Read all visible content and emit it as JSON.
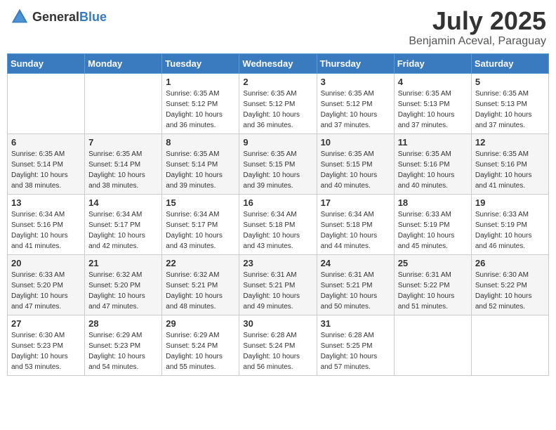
{
  "header": {
    "logo_general": "General",
    "logo_blue": "Blue",
    "title": "July 2025",
    "subtitle": "Benjamin Aceval, Paraguay"
  },
  "calendar": {
    "weekdays": [
      "Sunday",
      "Monday",
      "Tuesday",
      "Wednesday",
      "Thursday",
      "Friday",
      "Saturday"
    ],
    "weeks": [
      [
        {
          "day": null,
          "sunrise": null,
          "sunset": null,
          "daylight": null
        },
        {
          "day": null,
          "sunrise": null,
          "sunset": null,
          "daylight": null
        },
        {
          "day": "1",
          "sunrise": "Sunrise: 6:35 AM",
          "sunset": "Sunset: 5:12 PM",
          "daylight": "Daylight: 10 hours and 36 minutes."
        },
        {
          "day": "2",
          "sunrise": "Sunrise: 6:35 AM",
          "sunset": "Sunset: 5:12 PM",
          "daylight": "Daylight: 10 hours and 36 minutes."
        },
        {
          "day": "3",
          "sunrise": "Sunrise: 6:35 AM",
          "sunset": "Sunset: 5:12 PM",
          "daylight": "Daylight: 10 hours and 37 minutes."
        },
        {
          "day": "4",
          "sunrise": "Sunrise: 6:35 AM",
          "sunset": "Sunset: 5:13 PM",
          "daylight": "Daylight: 10 hours and 37 minutes."
        },
        {
          "day": "5",
          "sunrise": "Sunrise: 6:35 AM",
          "sunset": "Sunset: 5:13 PM",
          "daylight": "Daylight: 10 hours and 37 minutes."
        }
      ],
      [
        {
          "day": "6",
          "sunrise": "Sunrise: 6:35 AM",
          "sunset": "Sunset: 5:14 PM",
          "daylight": "Daylight: 10 hours and 38 minutes."
        },
        {
          "day": "7",
          "sunrise": "Sunrise: 6:35 AM",
          "sunset": "Sunset: 5:14 PM",
          "daylight": "Daylight: 10 hours and 38 minutes."
        },
        {
          "day": "8",
          "sunrise": "Sunrise: 6:35 AM",
          "sunset": "Sunset: 5:14 PM",
          "daylight": "Daylight: 10 hours and 39 minutes."
        },
        {
          "day": "9",
          "sunrise": "Sunrise: 6:35 AM",
          "sunset": "Sunset: 5:15 PM",
          "daylight": "Daylight: 10 hours and 39 minutes."
        },
        {
          "day": "10",
          "sunrise": "Sunrise: 6:35 AM",
          "sunset": "Sunset: 5:15 PM",
          "daylight": "Daylight: 10 hours and 40 minutes."
        },
        {
          "day": "11",
          "sunrise": "Sunrise: 6:35 AM",
          "sunset": "Sunset: 5:16 PM",
          "daylight": "Daylight: 10 hours and 40 minutes."
        },
        {
          "day": "12",
          "sunrise": "Sunrise: 6:35 AM",
          "sunset": "Sunset: 5:16 PM",
          "daylight": "Daylight: 10 hours and 41 minutes."
        }
      ],
      [
        {
          "day": "13",
          "sunrise": "Sunrise: 6:34 AM",
          "sunset": "Sunset: 5:16 PM",
          "daylight": "Daylight: 10 hours and 41 minutes."
        },
        {
          "day": "14",
          "sunrise": "Sunrise: 6:34 AM",
          "sunset": "Sunset: 5:17 PM",
          "daylight": "Daylight: 10 hours and 42 minutes."
        },
        {
          "day": "15",
          "sunrise": "Sunrise: 6:34 AM",
          "sunset": "Sunset: 5:17 PM",
          "daylight": "Daylight: 10 hours and 43 minutes."
        },
        {
          "day": "16",
          "sunrise": "Sunrise: 6:34 AM",
          "sunset": "Sunset: 5:18 PM",
          "daylight": "Daylight: 10 hours and 43 minutes."
        },
        {
          "day": "17",
          "sunrise": "Sunrise: 6:34 AM",
          "sunset": "Sunset: 5:18 PM",
          "daylight": "Daylight: 10 hours and 44 minutes."
        },
        {
          "day": "18",
          "sunrise": "Sunrise: 6:33 AM",
          "sunset": "Sunset: 5:19 PM",
          "daylight": "Daylight: 10 hours and 45 minutes."
        },
        {
          "day": "19",
          "sunrise": "Sunrise: 6:33 AM",
          "sunset": "Sunset: 5:19 PM",
          "daylight": "Daylight: 10 hours and 46 minutes."
        }
      ],
      [
        {
          "day": "20",
          "sunrise": "Sunrise: 6:33 AM",
          "sunset": "Sunset: 5:20 PM",
          "daylight": "Daylight: 10 hours and 47 minutes."
        },
        {
          "day": "21",
          "sunrise": "Sunrise: 6:32 AM",
          "sunset": "Sunset: 5:20 PM",
          "daylight": "Daylight: 10 hours and 47 minutes."
        },
        {
          "day": "22",
          "sunrise": "Sunrise: 6:32 AM",
          "sunset": "Sunset: 5:21 PM",
          "daylight": "Daylight: 10 hours and 48 minutes."
        },
        {
          "day": "23",
          "sunrise": "Sunrise: 6:31 AM",
          "sunset": "Sunset: 5:21 PM",
          "daylight": "Daylight: 10 hours and 49 minutes."
        },
        {
          "day": "24",
          "sunrise": "Sunrise: 6:31 AM",
          "sunset": "Sunset: 5:21 PM",
          "daylight": "Daylight: 10 hours and 50 minutes."
        },
        {
          "day": "25",
          "sunrise": "Sunrise: 6:31 AM",
          "sunset": "Sunset: 5:22 PM",
          "daylight": "Daylight: 10 hours and 51 minutes."
        },
        {
          "day": "26",
          "sunrise": "Sunrise: 6:30 AM",
          "sunset": "Sunset: 5:22 PM",
          "daylight": "Daylight: 10 hours and 52 minutes."
        }
      ],
      [
        {
          "day": "27",
          "sunrise": "Sunrise: 6:30 AM",
          "sunset": "Sunset: 5:23 PM",
          "daylight": "Daylight: 10 hours and 53 minutes."
        },
        {
          "day": "28",
          "sunrise": "Sunrise: 6:29 AM",
          "sunset": "Sunset: 5:23 PM",
          "daylight": "Daylight: 10 hours and 54 minutes."
        },
        {
          "day": "29",
          "sunrise": "Sunrise: 6:29 AM",
          "sunset": "Sunset: 5:24 PM",
          "daylight": "Daylight: 10 hours and 55 minutes."
        },
        {
          "day": "30",
          "sunrise": "Sunrise: 6:28 AM",
          "sunset": "Sunset: 5:24 PM",
          "daylight": "Daylight: 10 hours and 56 minutes."
        },
        {
          "day": "31",
          "sunrise": "Sunrise: 6:28 AM",
          "sunset": "Sunset: 5:25 PM",
          "daylight": "Daylight: 10 hours and 57 minutes."
        },
        {
          "day": null,
          "sunrise": null,
          "sunset": null,
          "daylight": null
        },
        {
          "day": null,
          "sunrise": null,
          "sunset": null,
          "daylight": null
        }
      ]
    ]
  }
}
